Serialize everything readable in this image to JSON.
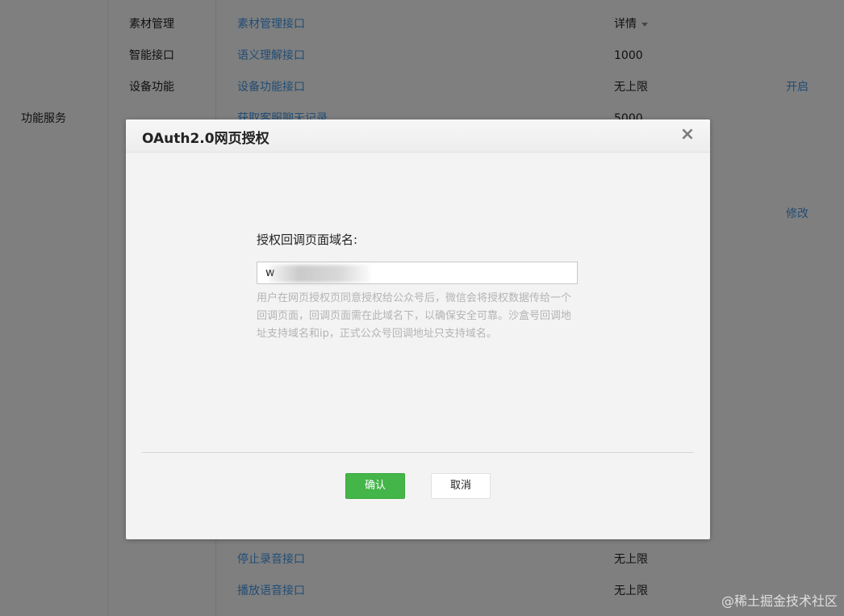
{
  "background": {
    "section_label": "功能服务",
    "rows_top": [
      {
        "category": "素材管理",
        "api": "素材管理接口",
        "quota": "详情",
        "quota_has_caret": true,
        "action": ""
      },
      {
        "category": "智能接口",
        "api": "语义理解接口",
        "quota": "1000",
        "action": ""
      },
      {
        "category": "设备功能",
        "api": "设备功能接口",
        "quota": "无上限",
        "action": "开启"
      },
      {
        "category": "",
        "api": "获取客服聊天记录",
        "quota": "5000",
        "action": ""
      }
    ],
    "right_action_middle": "修改",
    "rows_bottom": [
      {
        "api": "停止录音接口",
        "quota": "无上限"
      },
      {
        "api": "播放语音接口",
        "quota": "无上限"
      }
    ]
  },
  "dialog": {
    "title": "OAuth2.0网页授权",
    "close_symbol": "×",
    "field_label": "授权回调页面域名:",
    "field_value": "w",
    "hint": "用户在网页授权页同意授权给公众号后，微信会将授权数据传给一个回调页面，回调页面需在此域名下，以确保安全可靠。沙盒号回调地址支持域名和ip，正式公众号回调地址只支持域名。",
    "confirm_label": "确认",
    "cancel_label": "取消"
  },
  "watermark": "@稀土掘金技术社区",
  "colors": {
    "link": "#459ae9",
    "primary_button": "#44b549",
    "overlay": "rgba(0,0,0,0.5)"
  }
}
